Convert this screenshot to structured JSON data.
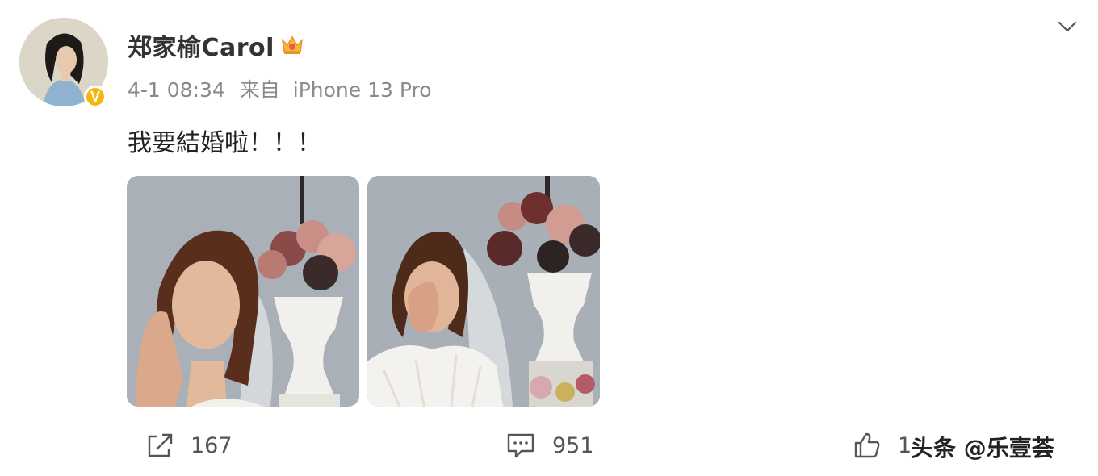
{
  "post": {
    "author": "郑家榆Carol",
    "verified_badge": "V",
    "member_icon": "crown-icon",
    "timestamp": "4-1 08:34",
    "source_prefix": "来自",
    "source_device": "iPhone 13 Pro",
    "text": "我要結婚啦！！！",
    "menu_icon": "chevron-down-icon"
  },
  "actions": {
    "repost_count": "167",
    "comment_count": "951",
    "like_count": "1"
  },
  "watermark": "头条 @乐壹荟",
  "colors": {
    "verified": "#f5b60b",
    "meta_text": "#8a8a8a",
    "body_text": "#222222"
  }
}
